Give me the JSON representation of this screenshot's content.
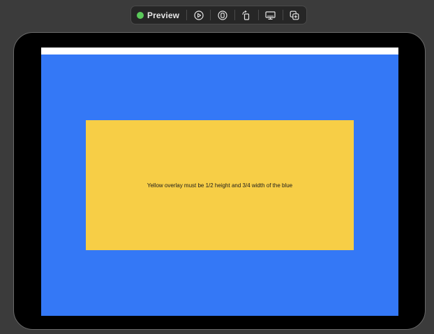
{
  "toolbar": {
    "preview_label": "Preview",
    "status_color": "#5ac95a",
    "buttons": [
      {
        "icon": "play-circle-icon"
      },
      {
        "icon": "selectable-mode-icon"
      },
      {
        "icon": "rotate-device-icon"
      },
      {
        "icon": "device-settings-icon"
      },
      {
        "icon": "duplicate-preview-icon"
      }
    ]
  },
  "canvas": {
    "background_color": "#3478f6",
    "overlay_color": "#f7ce46",
    "overlay_text": "Yellow overlay must be 1/2 height and 3/4 width of the blue"
  }
}
